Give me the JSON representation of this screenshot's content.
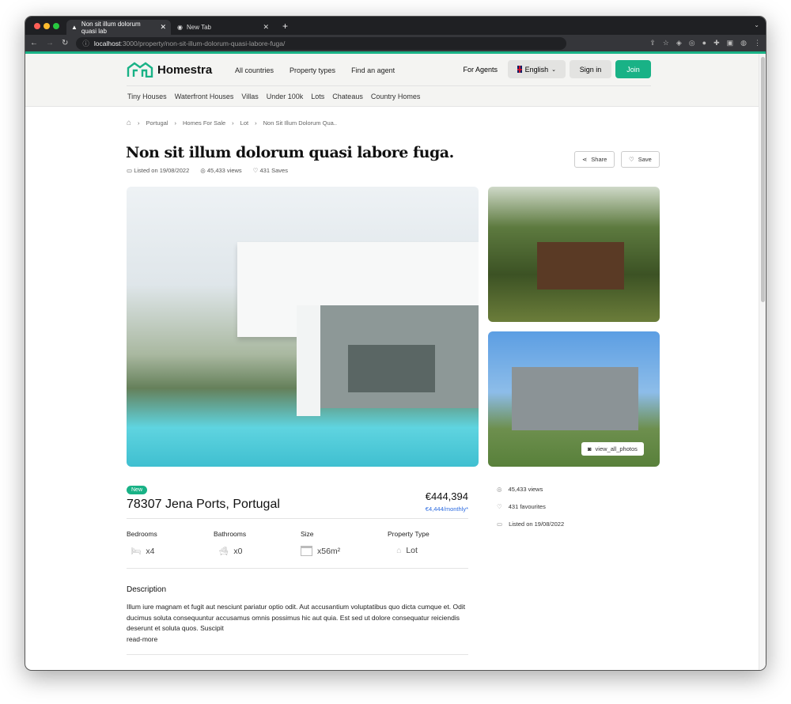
{
  "browser": {
    "tabs": [
      {
        "title": "Non sit illum dolorum quasi lab"
      },
      {
        "title": "New Tab"
      }
    ],
    "url_host": "localhost",
    "url_path": ":3000/property/non-sit-illum-dolorum-quasi-labore-fuga/"
  },
  "header": {
    "brand": "Homestra",
    "nav": [
      "All countries",
      "Property types",
      "Find an agent"
    ],
    "for_agents": "For Agents",
    "language": "English",
    "sign_in": "Sign in",
    "join": "Join",
    "categories": [
      "Tiny Houses",
      "Waterfront Houses",
      "Villas",
      "Under 100k",
      "Lots",
      "Chateaus",
      "Country Homes"
    ]
  },
  "breadcrumb": [
    "Portugal",
    "Homes For Sale",
    "Lot",
    "Non Sit Illum Dolorum Qua.."
  ],
  "listing": {
    "title": "Non sit illum dolorum quasi labore fuga.",
    "listed": "Listed on 19/08/2022",
    "views": "45,433 views",
    "saves": "431 Saves",
    "share": "Share",
    "save": "Save",
    "view_all": "view_all_photos",
    "badge": "New",
    "address": "78307 Jena Ports, Portugal",
    "price": "€444,394",
    "monthly": "€4,444/monthly*",
    "features": [
      {
        "label": "Bedrooms",
        "value": "x4",
        "icon": "bed-icon"
      },
      {
        "label": "Bathrooms",
        "value": "x0",
        "icon": "bathtub-icon"
      },
      {
        "label": "Size",
        "value": "x56m²",
        "icon": "size-icon"
      },
      {
        "label": "Property Type",
        "value": "Lot",
        "icon": "house-icon"
      }
    ],
    "side": {
      "views": "45,433 views",
      "favourites": "431 favourites",
      "listed": "Listed on 19/08/2022"
    },
    "description_title": "Description",
    "description": "Illum iure magnam et fugit aut nesciunt pariatur optio odit. Aut accusantium voluptatibus quo dicta cumque et. Odit ducimus soluta consequuntur accusamus omnis possimus hic aut quia. Est sed ut dolore consequatur reiciendis deserunt et soluta quos. Suscipit",
    "read_more": "read-more"
  }
}
